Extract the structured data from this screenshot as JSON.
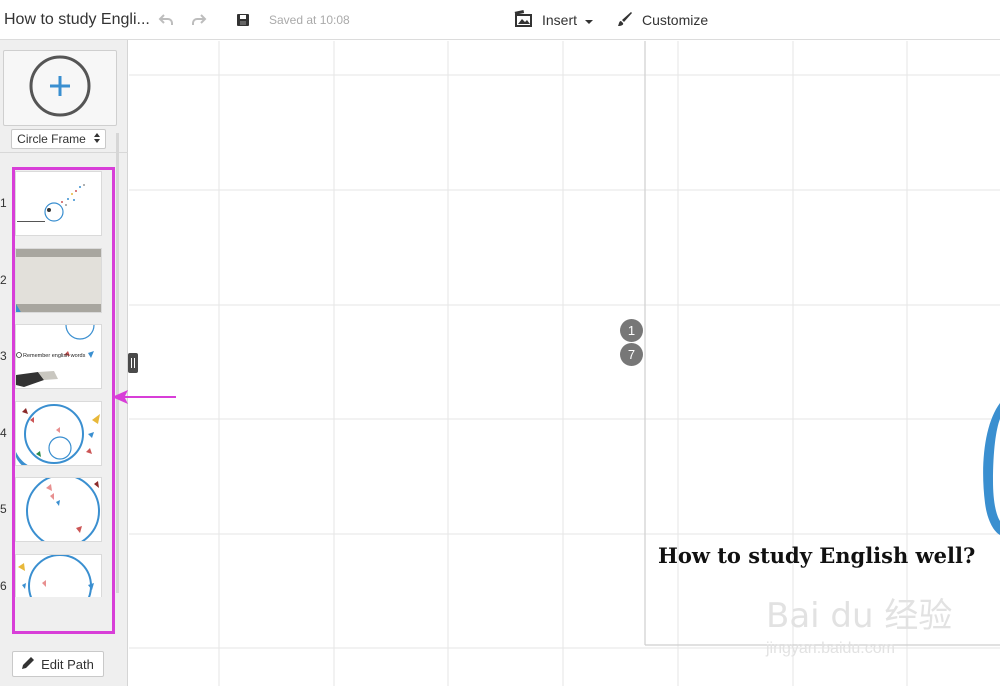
{
  "topbar": {
    "title": "How to study Engli...",
    "undo_icon": "undo-icon",
    "redo_icon": "redo-icon",
    "save_icon": "save-icon",
    "saved_status": "Saved at 10:08",
    "insert_label": "Insert",
    "customize_label": "Customize"
  },
  "sidebar": {
    "add_frame_icon": "plus-circle-icon",
    "frame_type": "Circle Frame",
    "thumbnails": [
      {
        "number": "1"
      },
      {
        "number": "2"
      },
      {
        "number": "3",
        "caption": "Remember english words"
      },
      {
        "number": "4"
      },
      {
        "number": "5"
      },
      {
        "number": "6"
      }
    ],
    "edit_path_label": "Edit Path"
  },
  "canvas": {
    "markers": [
      "1",
      "7"
    ],
    "slide_title": "How to study English well?",
    "watermark": "Bai du 经验",
    "watermark_url": "jingyan.baidu.com"
  },
  "colors": {
    "accent_blue": "#3a8fd0",
    "annotation_magenta": "#d83ed8",
    "marker_gray": "#777777"
  }
}
